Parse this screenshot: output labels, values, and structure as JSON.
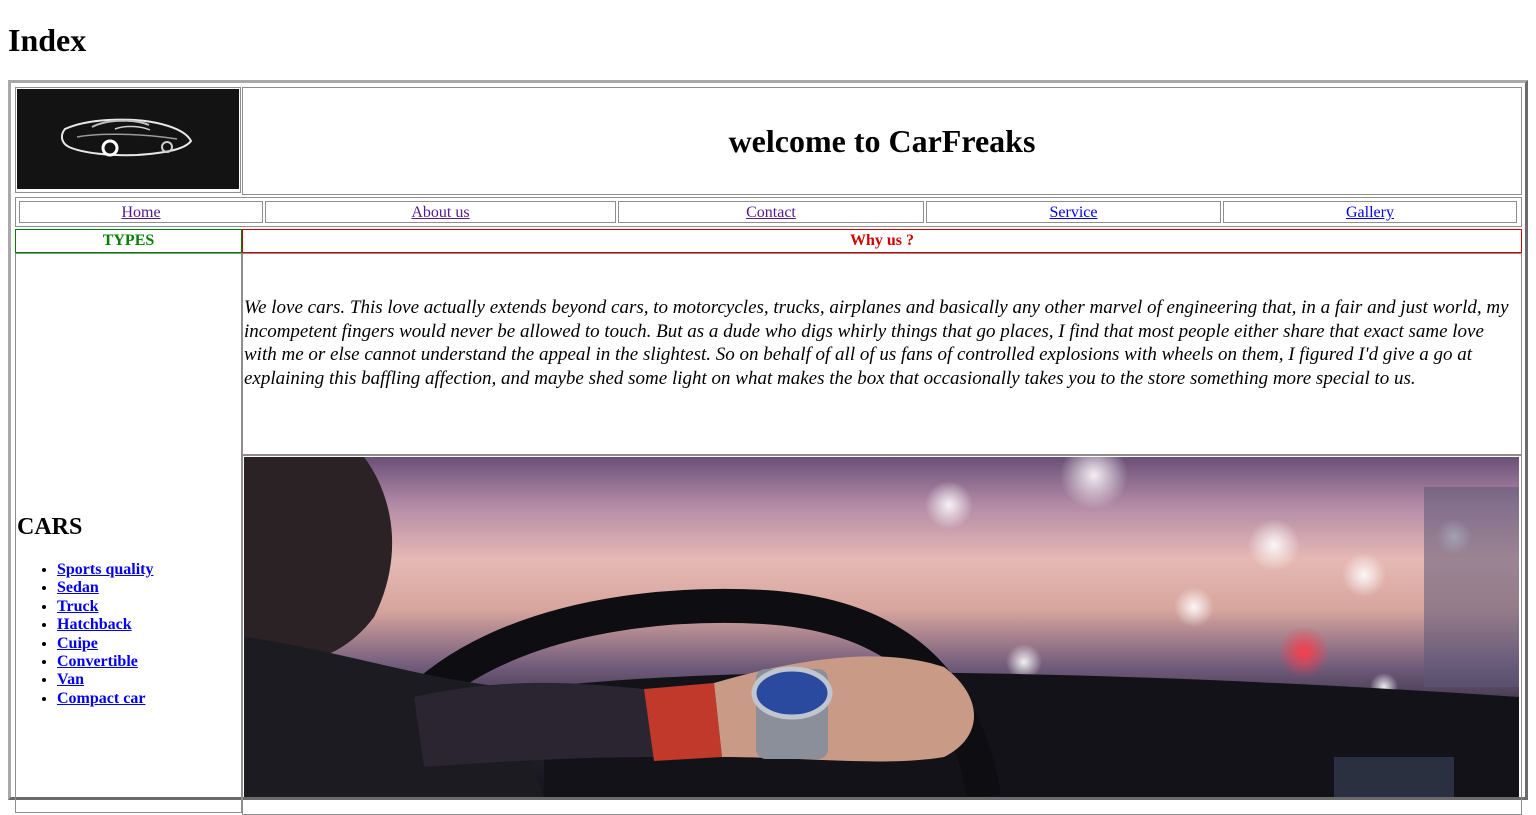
{
  "page": {
    "heading": "Index"
  },
  "header": {
    "welcome": "welcome to CarFreaks"
  },
  "nav": {
    "items": [
      "Home",
      "About us",
      "Contact",
      "Service",
      "Gallery"
    ]
  },
  "sections": {
    "types_label": "TYPES",
    "why_label": "Why us ?"
  },
  "about": {
    "text": "We love cars. This love actually extends beyond cars, to motorcycles, trucks, airplanes and basically any other marvel of engineering that, in a fair and just world, my incompetent fingers would never be allowed to touch. But as a dude who digs whirly things that go places, I find that most people either share that exact same love with me or else cannot understand the appeal in the slightest. So on behalf of all of us fans of controlled explosions with wheels on them, I figured I'd give a go at explaining this baffling affection, and maybe shed some light on what makes the box that occasionally takes you to the store something more special to us."
  },
  "sidebar": {
    "heading": "CARS",
    "items": [
      "Sports quality",
      "Sedan",
      "Truck",
      "Hatchback",
      "Cuipe",
      "Convertible",
      "Van",
      "Compact car"
    ]
  },
  "colors": {
    "types_green": "#008000",
    "why_red": "#d00000",
    "link_blue": "#0000ee",
    "visited_purple": "#551a8b"
  }
}
